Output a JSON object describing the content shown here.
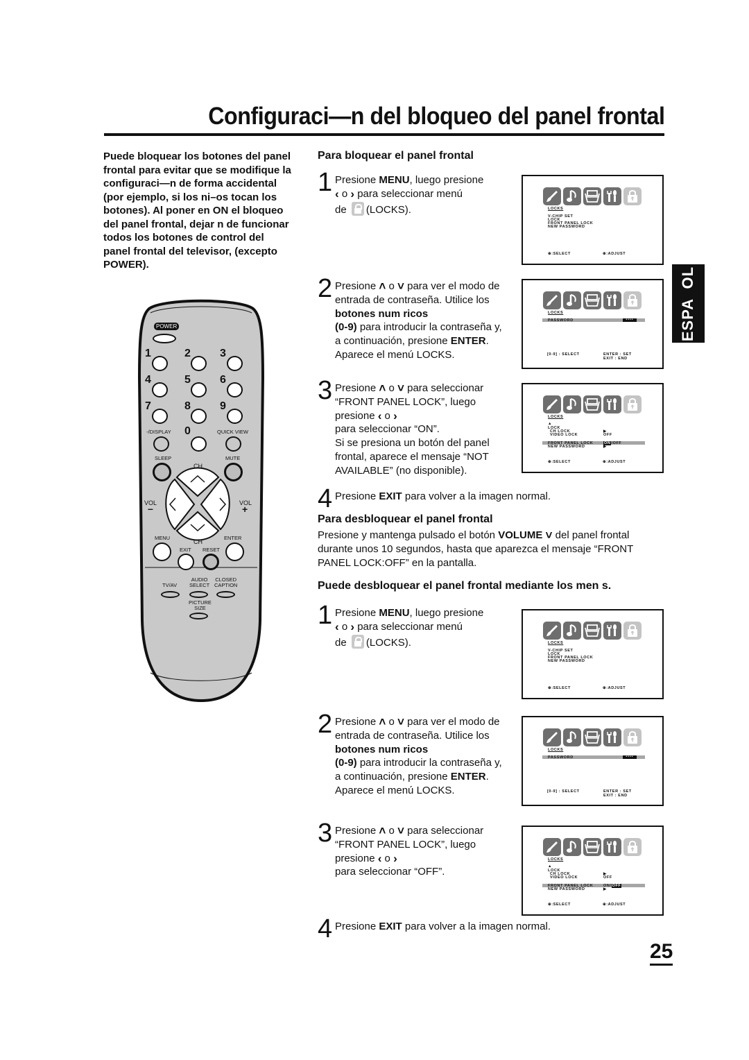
{
  "header": {
    "title": "Configuraci—n del bloqueo del panel frontal"
  },
  "intro": {
    "text": "Puede bloquear los botones del panel frontal para evitar que se modifique la configuraci—n de forma accidental (por ejemplo, si los ni–os tocan los botones). Al poner en ON el bloqueo del panel frontal, dejar  n de funcionar todos los botones de control del panel frontal del televisor, (excepto POWER)."
  },
  "language_tab": "ESPA  OL",
  "lock_section": {
    "heading": "Para bloquear el panel frontal",
    "steps": [
      {
        "num": "1",
        "parts": [
          "Presione ",
          "MENU",
          ", luego presione",
          " o ",
          " para seleccionar menú",
          "de ",
          "(LOCKS)."
        ]
      },
      {
        "num": "2",
        "parts": [
          "Presione ",
          " o ",
          " para ver el modo de entrada de contraseña. Utilice los ",
          "botones num  ricos",
          "(0-9)",
          " para introducir la contraseña y, a continuación, presione ",
          "ENTER",
          ". Aparece el menú LOCKS."
        ]
      },
      {
        "num": "3",
        "parts": [
          "Presione ",
          " o ",
          " para seleccionar “FRONT PANEL LOCK”, luego presione ",
          " o ",
          "para seleccionar “ON”.",
          "Si se presiona un botón del panel frontal, aparece el mensaje “NOT AVAILABLE” (no disponible)."
        ]
      },
      {
        "num": "4",
        "parts": [
          "Presione ",
          "EXIT",
          " para volver a la imagen normal."
        ]
      }
    ]
  },
  "unlock_section": {
    "heading": "Para desbloquear el panel frontal",
    "parts": [
      "Presione y mantenga pulsado el botón ",
      "VOLUME",
      " del panel frontal durante unos 10 segundos, hasta que aparezca el mensaje “FRONT PANEL LOCK:OFF” en la pantalla."
    ]
  },
  "menu_unlock_section": {
    "heading": "Puede desbloquear el panel frontal mediante los men  s.",
    "steps": [
      {
        "num": "1",
        "parts": [
          "Presione ",
          "MENU",
          ", luego presione",
          " o ",
          " para seleccionar menú",
          "de ",
          "(LOCKS)."
        ]
      },
      {
        "num": "2",
        "parts": [
          "Presione ",
          " o ",
          " para ver el modo de entrada de contraseña. Utilice los ",
          "botones num  ricos",
          "(0-9)",
          " para introducir la contraseña y, a continuación, presione ",
          "ENTER",
          ". Aparece el menú LOCKS."
        ]
      },
      {
        "num": "3",
        "parts": [
          "Presione ",
          " o ",
          " para seleccionar “FRONT PANEL LOCK”, luego presione ",
          " o ",
          "para seleccionar “OFF”."
        ]
      },
      {
        "num": "4",
        "parts": [
          "Presione ",
          "EXIT",
          " para volver a la imagen normal."
        ]
      }
    ]
  },
  "icons": {
    "left": "‹",
    "right": "›",
    "up": "⌃",
    "down": "⌄"
  },
  "osd": {
    "menu_title": "LOCKS",
    "locks_menu": {
      "items": [
        "V-CHIP SET",
        "LOCK",
        "FRONT PANEL LOCK",
        "NEW PASSWORD"
      ],
      "footer_left": "⊕:SELECT",
      "footer_right": "⊕:ADJUST"
    },
    "password": {
      "label": "PASSWORD",
      "value": "••••",
      "footer_left": "[0-9] : SELECT",
      "footer_right_1": "ENTER : SET",
      "footer_right_2": "EXIT : END"
    },
    "lock_detail": {
      "up_marker": "▲",
      "lock": "LOCK",
      "ch_lock": "CH LOCK",
      "ch_lock_value": "▶",
      "video_lock": "VIDEO LOCK",
      "video_lock_value": "OFF",
      "front_panel_lock": "FRONT PANEL LOCK",
      "on": "ON",
      "sep": "/",
      "off": "OFF",
      "new_password": "NEW PASSWORD",
      "new_password_value": "▶",
      "footer_left": "⊕:SELECT",
      "footer_right": "⊕:ADJUST"
    }
  },
  "remote": {
    "power": "POWER",
    "digits": [
      "1",
      "2",
      "3",
      "4",
      "5",
      "6",
      "7",
      "8",
      "9",
      "0"
    ],
    "display": "-/DISPLAY",
    "quick_view": "QUICK VIEW",
    "sleep": "SLEEP",
    "mute": "MUTE",
    "ch": "CH",
    "vol": "VOL",
    "minus": "–",
    "plus": "+",
    "menu": "MENU",
    "enter": "ENTER",
    "exit": "EXIT",
    "reset": "RESET",
    "tv_av": "TV/AV",
    "audio_select_1": "AUDIO",
    "audio_select_2": "SELECT",
    "closed_caption_1": "CLOSED",
    "closed_caption_2": "CAPTION",
    "picture_size_1": "PICTURE",
    "picture_size_2": "SIZE"
  },
  "page_number": "25"
}
